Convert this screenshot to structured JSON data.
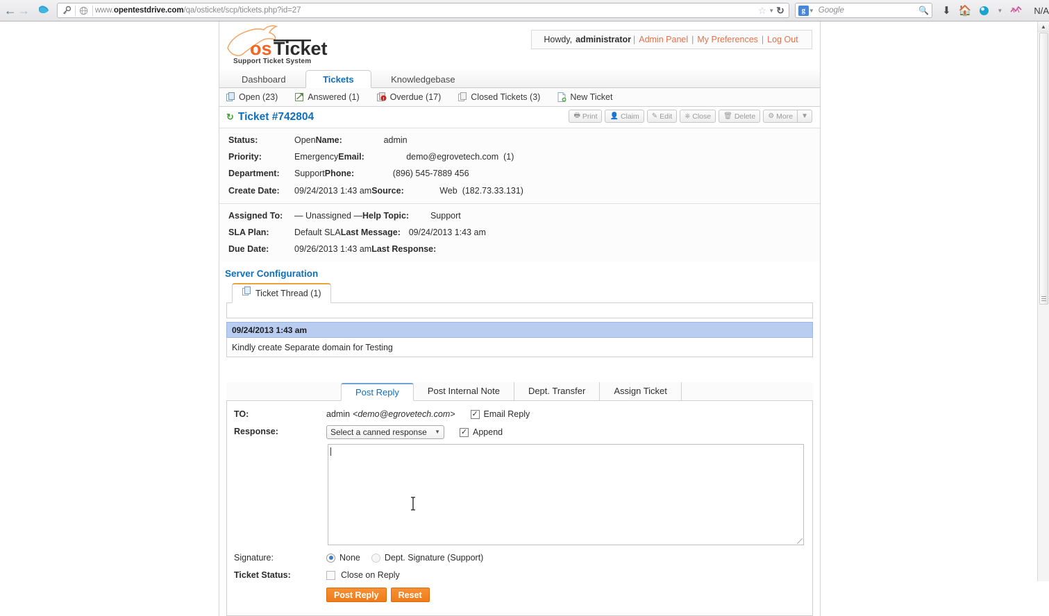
{
  "browser": {
    "back_icon": "back-arrow-icon",
    "forward_icon": "forward-arrow-icon",
    "url_prefix": "www.",
    "url_domain": "opentestdrive.com",
    "url_path": "/qa/osticket/scp/tickets.php?id=27",
    "search_placeholder": "Google",
    "status_label": "N/A"
  },
  "header": {
    "logo_text": "osTicket",
    "logo_subtitle": "Support Ticket System",
    "greeting_prefix": "Howdy,",
    "user": "administrator",
    "links": [
      "Admin Panel",
      "My Preferences",
      "Log Out"
    ]
  },
  "nav": {
    "tabs": [
      {
        "label": "Dashboard",
        "active": false
      },
      {
        "label": "Tickets",
        "active": true
      },
      {
        "label": "Knowledgebase",
        "active": false
      }
    ],
    "subnav": [
      {
        "label": "Open (23)",
        "icon": "copy-icon"
      },
      {
        "label": "Answered (1)",
        "icon": "answered-icon"
      },
      {
        "label": "Overdue (17)",
        "icon": "overdue-icon"
      },
      {
        "label": "Closed Tickets (3)",
        "icon": "closed-icon"
      },
      {
        "label": "New Ticket",
        "icon": "new-ticket-icon"
      }
    ]
  },
  "ticket": {
    "title": "Ticket #742804",
    "toolbar": [
      {
        "label": "Print",
        "icon": "printer-icon"
      },
      {
        "label": "Claim",
        "icon": "user-icon"
      },
      {
        "label": "Edit",
        "icon": "edit-icon"
      },
      {
        "label": "Close",
        "icon": "close-circle-icon"
      },
      {
        "label": "Delete",
        "icon": "trash-icon"
      },
      {
        "label": "More",
        "icon": "gear-icon"
      }
    ],
    "details_left": [
      {
        "label": "Status:",
        "value": "Open"
      },
      {
        "label": "Priority:",
        "value": "Emergency"
      },
      {
        "label": "Department:",
        "value": "Support"
      },
      {
        "label": "Create Date:",
        "value": "09/24/2013 1:43 am"
      }
    ],
    "details_right": [
      {
        "label": "Name:",
        "value": "admin"
      },
      {
        "label": "Email:",
        "value": "demo@egrovetech.com",
        "suffix": "(1)"
      },
      {
        "label": "Phone:",
        "value": "(896) 545-7889 456"
      },
      {
        "label": "Source:",
        "value": "Web",
        "suffix": "(182.73.33.131)"
      }
    ],
    "details2_left": [
      {
        "label": "Assigned To:",
        "value": "— Unassigned —"
      },
      {
        "label": "SLA Plan:",
        "value": "Default SLA"
      },
      {
        "label": "Due Date:",
        "value": "09/26/2013 1:43 am"
      }
    ],
    "details2_right": [
      {
        "label": "Help Topic:",
        "value": "Support"
      },
      {
        "label": "Last Message:",
        "value": "09/24/2013 1:43 am"
      },
      {
        "label": "Last Response:",
        "value": ""
      }
    ],
    "subject": "Server Configuration",
    "thread_tab": "Ticket Thread (1)",
    "messages": [
      {
        "timestamp": "09/24/2013 1:43 am",
        "body": "Kindly create Separate domain for Testing"
      }
    ]
  },
  "reply": {
    "tabs": [
      {
        "label": "Post Reply",
        "active": true
      },
      {
        "label": "Post Internal Note",
        "active": false
      },
      {
        "label": "Dept. Transfer",
        "active": false
      },
      {
        "label": "Assign Ticket",
        "active": false
      }
    ],
    "to_label": "TO:",
    "to_value_name": "admin",
    "to_value_email": "<demo@egrovetech.com>",
    "email_reply_label": "Email Reply",
    "email_reply_checked": true,
    "response_label": "Response:",
    "canned_selected": "Select a canned response",
    "append_label": "Append",
    "append_checked": true,
    "body_value": "",
    "signature_label": "Signature:",
    "signature_options": [
      {
        "label": "None",
        "selected": true
      },
      {
        "label": "Dept. Signature (Support)",
        "selected": false
      }
    ],
    "ticket_status_label": "Ticket Status:",
    "close_on_reply_label": "Close on Reply",
    "close_on_reply_checked": false,
    "submit_label": "Post Reply",
    "reset_label": "Reset"
  }
}
